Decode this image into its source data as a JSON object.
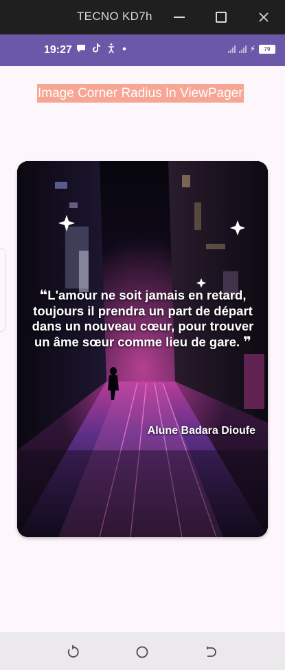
{
  "window": {
    "title": "TECNO KD7h",
    "icons": [
      "minimize-icon",
      "maximize-icon",
      "close-icon"
    ]
  },
  "status_bar": {
    "time": "19:27",
    "battery": "79",
    "icons": [
      "message-icon",
      "tiktok-icon",
      "accessibility-icon",
      "dot-icon",
      "signal-icon",
      "signal-icon",
      "charging-icon",
      "battery-icon"
    ],
    "color": "#6b58a8"
  },
  "app": {
    "title": "Image Corner Radius In ViewPager",
    "title_background": "#f7a594"
  },
  "card": {
    "quote_open": "❝",
    "quote_text": "L'amour ne soit jamais en retard, toujours il prendra un part de départ dans un nouveau cœur, pour trouver un âme sœur comme lieu de gare.",
    "quote_close": "❞",
    "author": "Alune Badara Dioufe"
  },
  "nav_bar": {
    "icons": [
      "back-icon",
      "home-icon",
      "recents-icon"
    ]
  }
}
